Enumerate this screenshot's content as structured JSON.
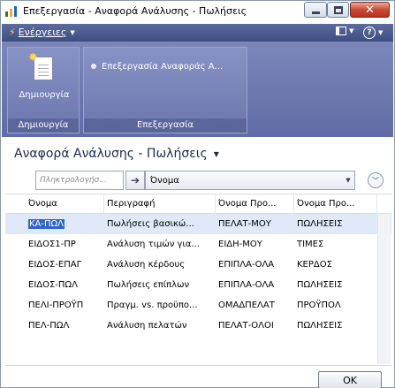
{
  "window": {
    "title": "Επεξεργασία - Αναφορά Ανάλυσης - Πωλήσεις",
    "close_glyph": "✕"
  },
  "ribbon": {
    "actions_label": "Ενέργειες",
    "groups": [
      {
        "label": "Δημιουργία",
        "button_label": "Δημιουργία"
      },
      {
        "label": "Επεξεργασία",
        "button_label": "Επεξεργασία Αναφοράς Α..."
      }
    ]
  },
  "page": {
    "title": "Αναφορά Ανάλυσης - Πωλήσεις"
  },
  "filter": {
    "search_placeholder": "Πληκτρολογήσ...",
    "field_value": "Όνομα"
  },
  "table": {
    "columns": [
      "Όνομα",
      "Περιγραφή",
      "Όνομα Προ...",
      "Όνομα Προ..."
    ],
    "rows": [
      [
        "ΚΑ-ΠΩΛ",
        "Πωλήσεις βασικώ...",
        "ΠΕΛΑΤ-ΜΟΥ",
        "ΠΩΛΗΣΕΙΣ"
      ],
      [
        "ΕΙΔΟΣ1-ΠΡ",
        "Ανάλυση τιμών για...",
        "ΕΙΔΗ-ΜΟΥ",
        "ΤΙΜΕΣ"
      ],
      [
        "ΕΙΔΟΣ-ΕΠΑΓ",
        "Ανάλυση κέρδους",
        "ΕΠΙΠΛΑ-ΟΛΑ",
        "ΚΕΡΔΟΣ"
      ],
      [
        "ΕΙΔΟΣ-ΠΩΛ",
        "Πωλήσεις επίπλων",
        "ΕΠΙΠΛΑ-ΟΛΑ",
        "ΠΩΛΗΣΕΙΣ"
      ],
      [
        "ΠΕΛΙ-ΠΡΟΫΠ",
        "Πραγμ. vs. προϋπο...",
        "ΟΜΑΔΠΕΛΑΤ",
        "ΠΡΟΫΠΟΛ"
      ],
      [
        "ΠΕΛ-ΠΩΛ",
        "Ανάλυση πελατών",
        "ΠΕΛΑΤ-ΟΛΟΙ",
        "ΠΩΛΗΣΕΙΣ"
      ]
    ],
    "selected_row": 0
  },
  "footer": {
    "ok_label": "OK"
  },
  "colors": {
    "ribbon_bar": "#3e4d80",
    "ribbon_body": "#6b76ad",
    "selection": "#2f63c9",
    "selected_row_bg": "#dfe9f8",
    "close_button": "#c94a35"
  },
  "icons": [
    "app-icon",
    "bolt-icon",
    "layout-icon",
    "help-icon",
    "new-document-icon",
    "edit-bullet-icon",
    "go-arrow-icon",
    "expand-chevron-icon"
  ]
}
